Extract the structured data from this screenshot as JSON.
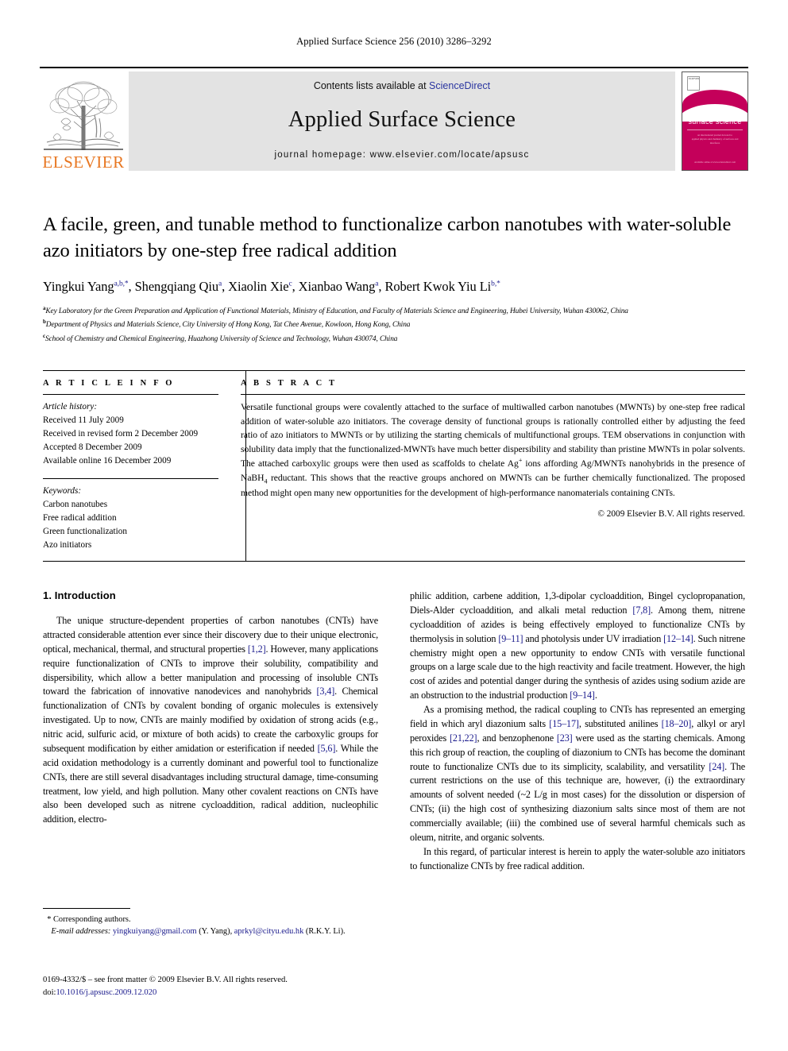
{
  "running_head": "Applied Surface Science 256 (2010) 3286–3292",
  "masthead": {
    "contents_prefix": "Contents lists available at ",
    "sciencedirect": "ScienceDirect",
    "journal_title": "Applied Surface Science",
    "homepage": "journal homepage: www.elsevier.com/locate/apsusc",
    "publisher_word": "ELSEVIER",
    "cover": {
      "title_line1": "applied",
      "title_line2": "surface science",
      "sub_line1": "an international journal devoted to",
      "sub_line2": "applied physics and chemistry of surfaces and interfaces",
      "foot_line": "Available online at www.sciencedirect.com",
      "logo_text": "ELSEVIER"
    },
    "accent_link_color": "#2a35a0",
    "elsevier_orange": "#E87722",
    "cover_crimson": "#c4005a",
    "banner_gray": "#e3e3e3"
  },
  "article": {
    "title": "A facile, green, and tunable method to functionalize carbon nanotubes with water-soluble azo initiators by one-step free radical addition",
    "authors_html": "Yingkui Yang<sup>a,b,*</sup>, Shengqiang Qiu<sup>a</sup>, Xiaolin Xie<sup>c</sup>, Xianbao Wang<sup>a</sup>, Robert Kwok Yiu Li<sup>b,*</sup>",
    "affiliations": [
      {
        "marker": "a",
        "text": "Key Laboratory for the Green Preparation and Application of Functional Materials, Ministry of Education, and Faculty of Materials Science and Engineering, Hubei University, Wuhan 430062, China"
      },
      {
        "marker": "b",
        "text": "Department of Physics and Materials Science, City University of Hong Kong, Tat Chee Avenue, Kowloon, Hong Kong, China"
      },
      {
        "marker": "c",
        "text": "School of Chemistry and Chemical Engineering, Huazhong University of Science and Technology, Wuhan 430074, China"
      }
    ]
  },
  "article_info": {
    "heading": "A R T I C L E   I N F O",
    "history_label": "Article history:",
    "history": [
      "Received 11 July 2009",
      "Received in revised form 2 December 2009",
      "Accepted 8 December 2009",
      "Available online 16 December 2009"
    ],
    "keywords_label": "Keywords:",
    "keywords": [
      "Carbon nanotubes",
      "Free radical addition",
      "Green functionalization",
      "Azo initiators"
    ]
  },
  "abstract": {
    "heading": "A B S T R A C T",
    "paragraph_1": "Versatile functional groups were covalently attached to the surface of multiwalled carbon nanotubes (MWNTs) by one-step free radical addition of water-soluble azo initiators. The coverage density of functional groups is rationally controlled either by adjusting the feed ratio of azo initiators to MWNTs or by utilizing the starting chemicals of multifunctional groups. TEM observations in conjunction with solubility data imply that the functionalized-MWNTs have much better dispersibility and stability than pristine MWNTs in polar solvents. The attached carboxylic groups were then used as scaffolds to chelate Ag",
    "paragraph_1_sup": "+",
    "paragraph_1b": " ions affording Ag/MWNTs nanohybrids in the presence of NaBH",
    "paragraph_1_sub": "4",
    "paragraph_1c": " reductant. This shows that the reactive groups anchored on MWNTs can be further chemically functionalized. The proposed method might open many new opportunities for the development of high-performance nanomaterials containing CNTs.",
    "copyright": "© 2009 Elsevier B.V. All rights reserved."
  },
  "body": {
    "section_title": "1. Introduction",
    "left_paragraphs": [
      "The unique structure-dependent properties of carbon nanotubes (CNTs) have attracted considerable attention ever since their discovery due to their unique electronic, optical, mechanical, thermal, and structural properties [1,2]. However, many applications require functionalization of CNTs to improve their solubility, compatibility and dispersibility, which allow a better manipulation and processing of insoluble CNTs toward the fabrication of innovative nanodevices and nanohybrids [3,4]. Chemical functionalization of CNTs by covalent bonding of organic molecules is extensively investigated. Up to now, CNTs are mainly modified by oxidation of strong acids (e.g., nitric acid, sulfuric acid, or mixture of both acids) to create the carboxylic groups for subsequent modification by either amidation or esterification if needed [5,6]. While the acid oxidation methodology is a currently dominant and powerful tool to functionalize CNTs, there are still several disadvantages including structural damage, time-consuming treatment, low yield, and high pollution. Many other covalent reactions on CNTs have also been developed such as nitrene cycloaddition, radical addition, nucleophilic addition, electro-"
    ],
    "right_paragraphs": [
      "philic addition, carbene addition, 1,3-dipolar cycloaddition, Bingel cyclopropanation, Diels-Alder cycloaddition, and alkali metal reduction [7,8]. Among them, nitrene cycloaddition of azides is being effectively employed to functionalize CNTs by thermolysis in solution [9–11] and photolysis under UV irradiation [12–14]. Such nitrene chemistry might open a new opportunity to endow CNTs with versatile functional groups on a large scale due to the high reactivity and facile treatment. However, the high cost of azides and potential danger during the synthesis of azides using sodium azide are an obstruction to the industrial production [9–14].",
      "As a promising method, the radical coupling to CNTs has represented an emerging field in which aryl diazonium salts [15–17], substituted anilines [18–20], alkyl or aryl peroxides [21,22], and benzophenone [23] were used as the starting chemicals. Among this rich group of reaction, the coupling of diazonium to CNTs has become the dominant route to functionalize CNTs due to its simplicity, scalability, and versatility [24]. The current restrictions on the use of this technique are, however, (i) the extraordinary amounts of solvent needed (~2 L/g in most cases) for the dissolution or dispersion of CNTs; (ii) the high cost of synthesizing diazonium salts since most of them are not commercially available; (iii) the combined use of several harmful chemicals such as oleum, nitrite, and organic solvents.",
      "In this regard, of particular interest is herein to apply the water-soluble azo initiators to functionalize CNTs by free radical addition."
    ]
  },
  "footnotes": {
    "corresponding": "Corresponding authors.",
    "email_label": "E-mail addresses:",
    "email_1": "yingkuiyang@gmail.com",
    "email_1_owner": "(Y. Yang),",
    "email_2": "aprkyl@cityu.edu.hk",
    "email_2_owner": "(R.K.Y. Li).",
    "issn_line": "0169-4332/$ – see front matter © 2009 Elsevier B.V. All rights reserved.",
    "doi_label": "doi:",
    "doi_value": "10.1016/j.apsusc.2009.12.020"
  }
}
